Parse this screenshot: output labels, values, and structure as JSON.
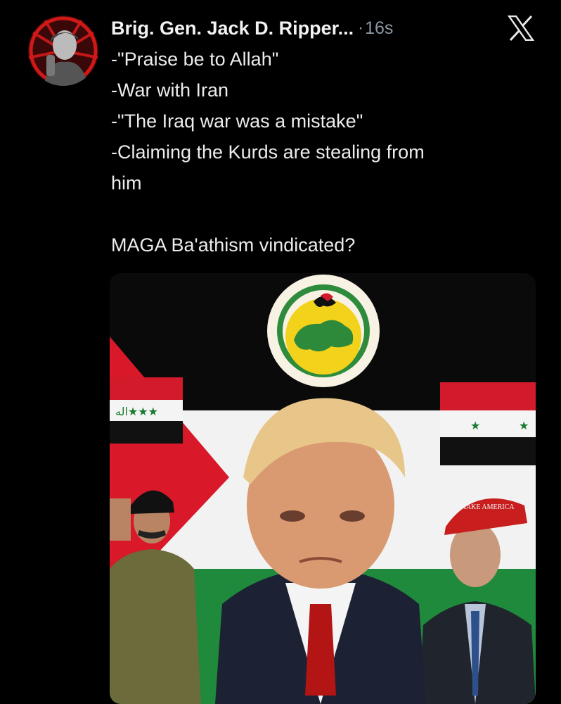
{
  "tweet": {
    "author": "Brig. Gen. Jack D. Ripper...",
    "separator": "·",
    "time": "16s",
    "lines": [
      "-\"Praise be to Allah\"",
      "-War with Iran",
      "-\"The Iraq war was a mistake\"",
      "-Claiming the Kurds are stealing from",
      "him",
      "MAGA Ba'athism vindicated?"
    ]
  },
  "icons": {
    "platform": "x-logo-icon",
    "avatar": "profile-avatar"
  },
  "colors": {
    "background": "#000000",
    "text": "#e7e9ea",
    "muted": "#8b98a5"
  }
}
